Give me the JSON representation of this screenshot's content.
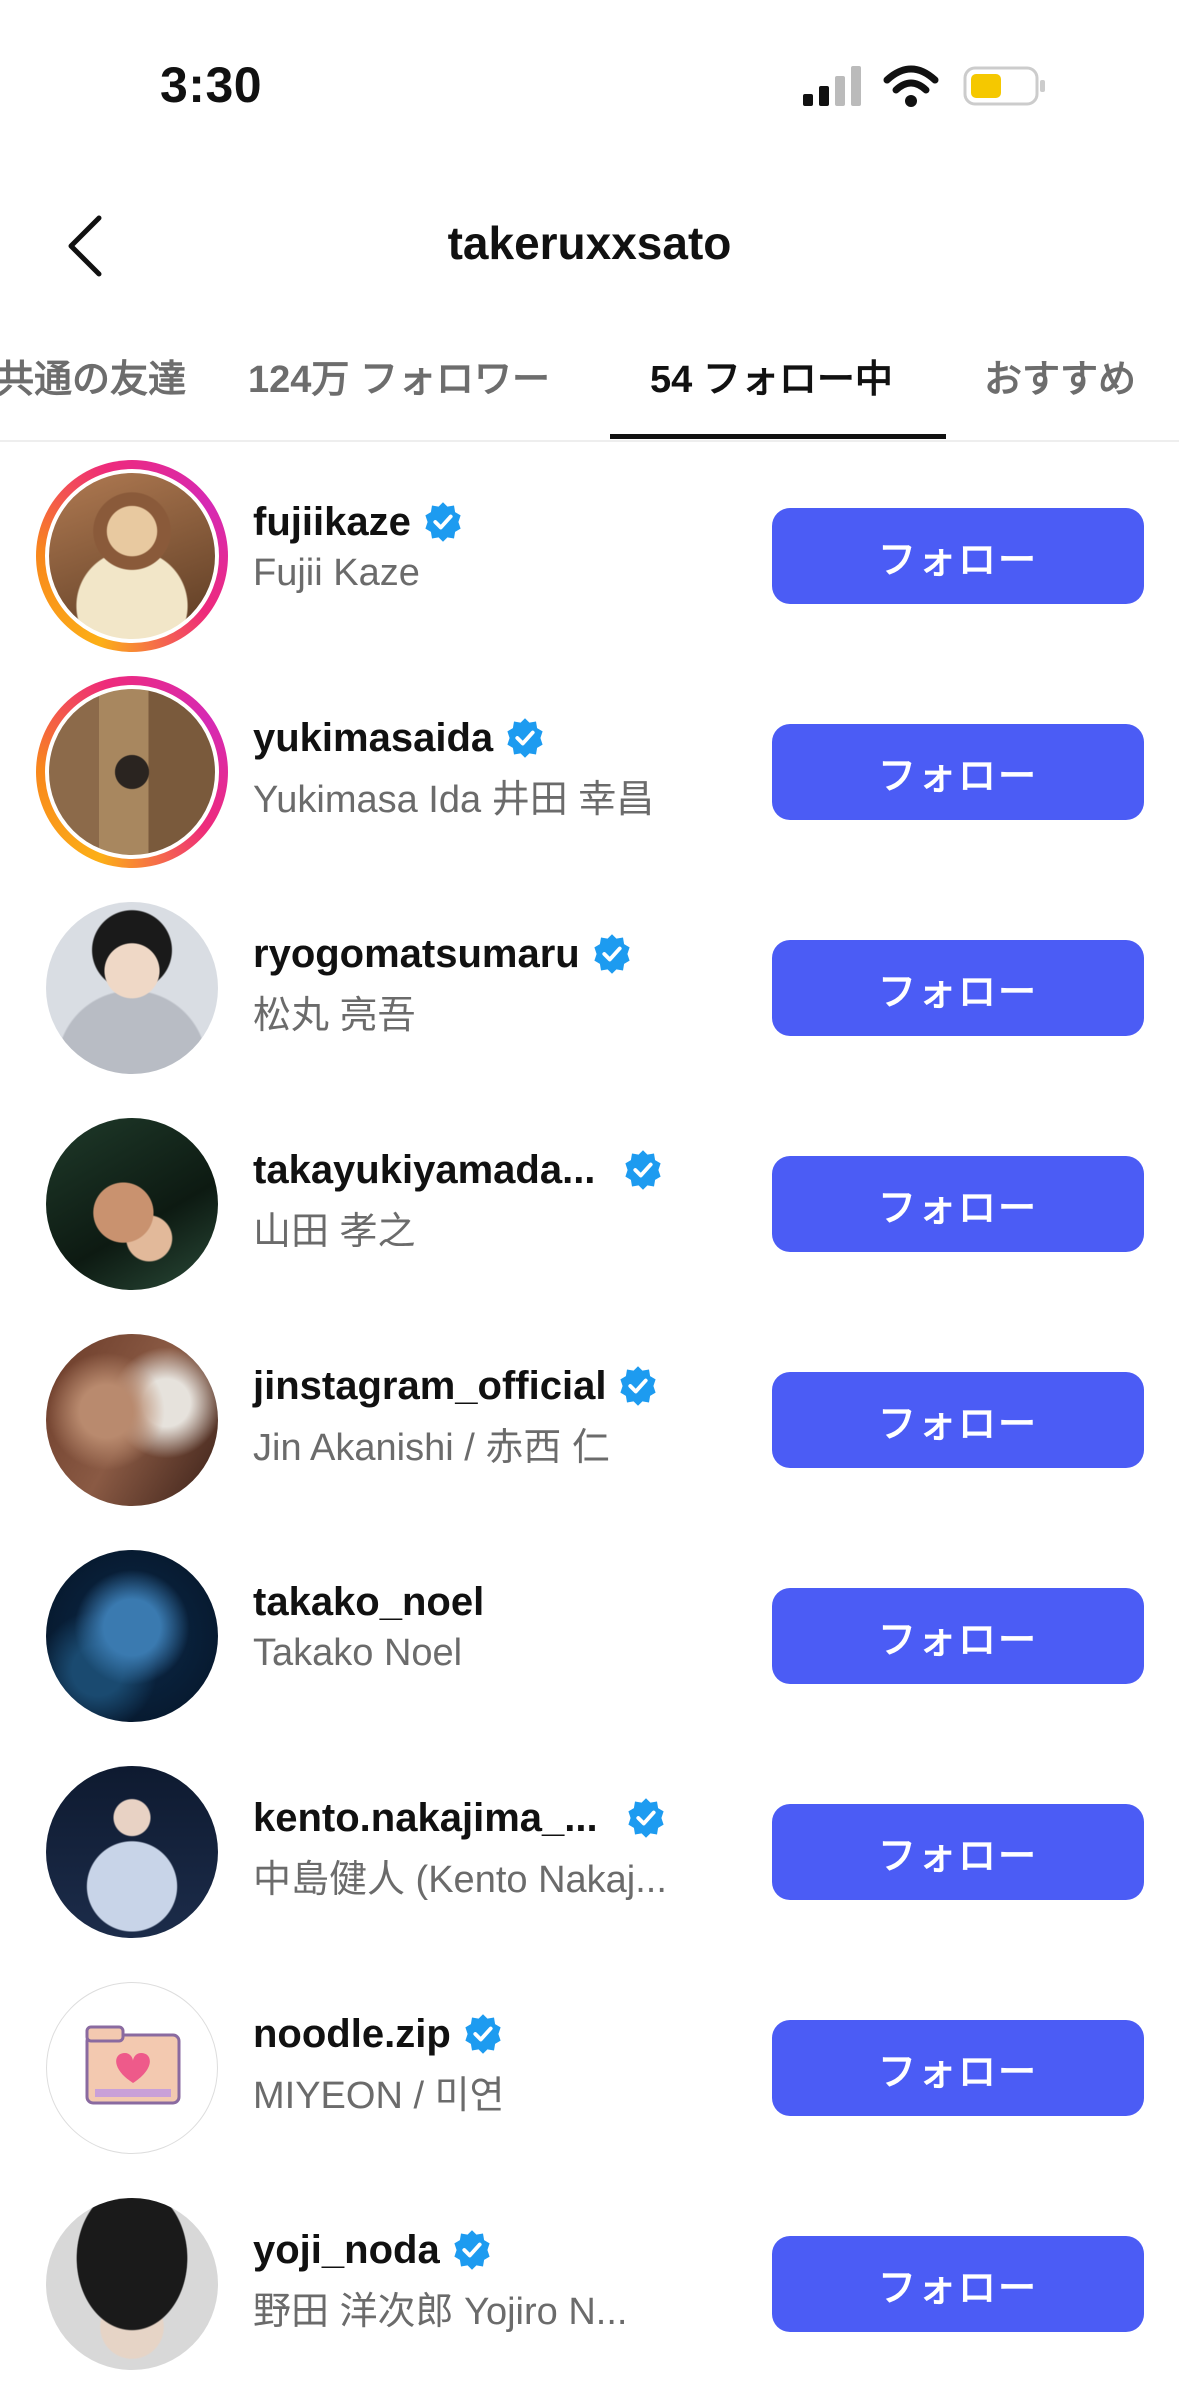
{
  "status": {
    "time": "3:30"
  },
  "header": {
    "title": "takeruxxsato"
  },
  "tabs": [
    {
      "label": "共通の友達"
    },
    {
      "label": "124万 フォロワー"
    },
    {
      "label": "54 フォロー中"
    },
    {
      "label": "おすすめ"
    }
  ],
  "accent_color": "#4b5cf5",
  "users": [
    {
      "username": "fujiikaze",
      "fullname": "Fujii Kaze",
      "verified": true,
      "story": true,
      "button": "フォロー"
    },
    {
      "username": "yukimasaida",
      "fullname": "Yukimasa Ida 井田 幸昌",
      "verified": true,
      "story": true,
      "button": "フォロー"
    },
    {
      "username": "ryogomatsumaru",
      "fullname": "松丸 亮吾",
      "verified": true,
      "story": false,
      "button": "フォロー"
    },
    {
      "username": "takayukiyamada...",
      "fullname": "山田 孝之",
      "verified": true,
      "story": false,
      "button": "フォロー"
    },
    {
      "username": "jinstagram_official",
      "fullname": "Jin Akanishi / 赤西 仁",
      "verified": true,
      "story": false,
      "button": "フォロー"
    },
    {
      "username": "takako_noel",
      "fullname": "Takako Noel",
      "verified": false,
      "story": false,
      "button": "フォロー"
    },
    {
      "username": "kento.nakajima_...",
      "fullname": "中島健人 (Kento Nakaj...",
      "verified": true,
      "story": false,
      "button": "フォロー"
    },
    {
      "username": "noodle.zip",
      "fullname": "MIYEON / 미연",
      "verified": true,
      "story": false,
      "button": "フォロー"
    },
    {
      "username": "yoji_noda",
      "fullname": "野田 洋次郎 Yojiro N...",
      "verified": true,
      "story": false,
      "button": "フォロー"
    }
  ]
}
